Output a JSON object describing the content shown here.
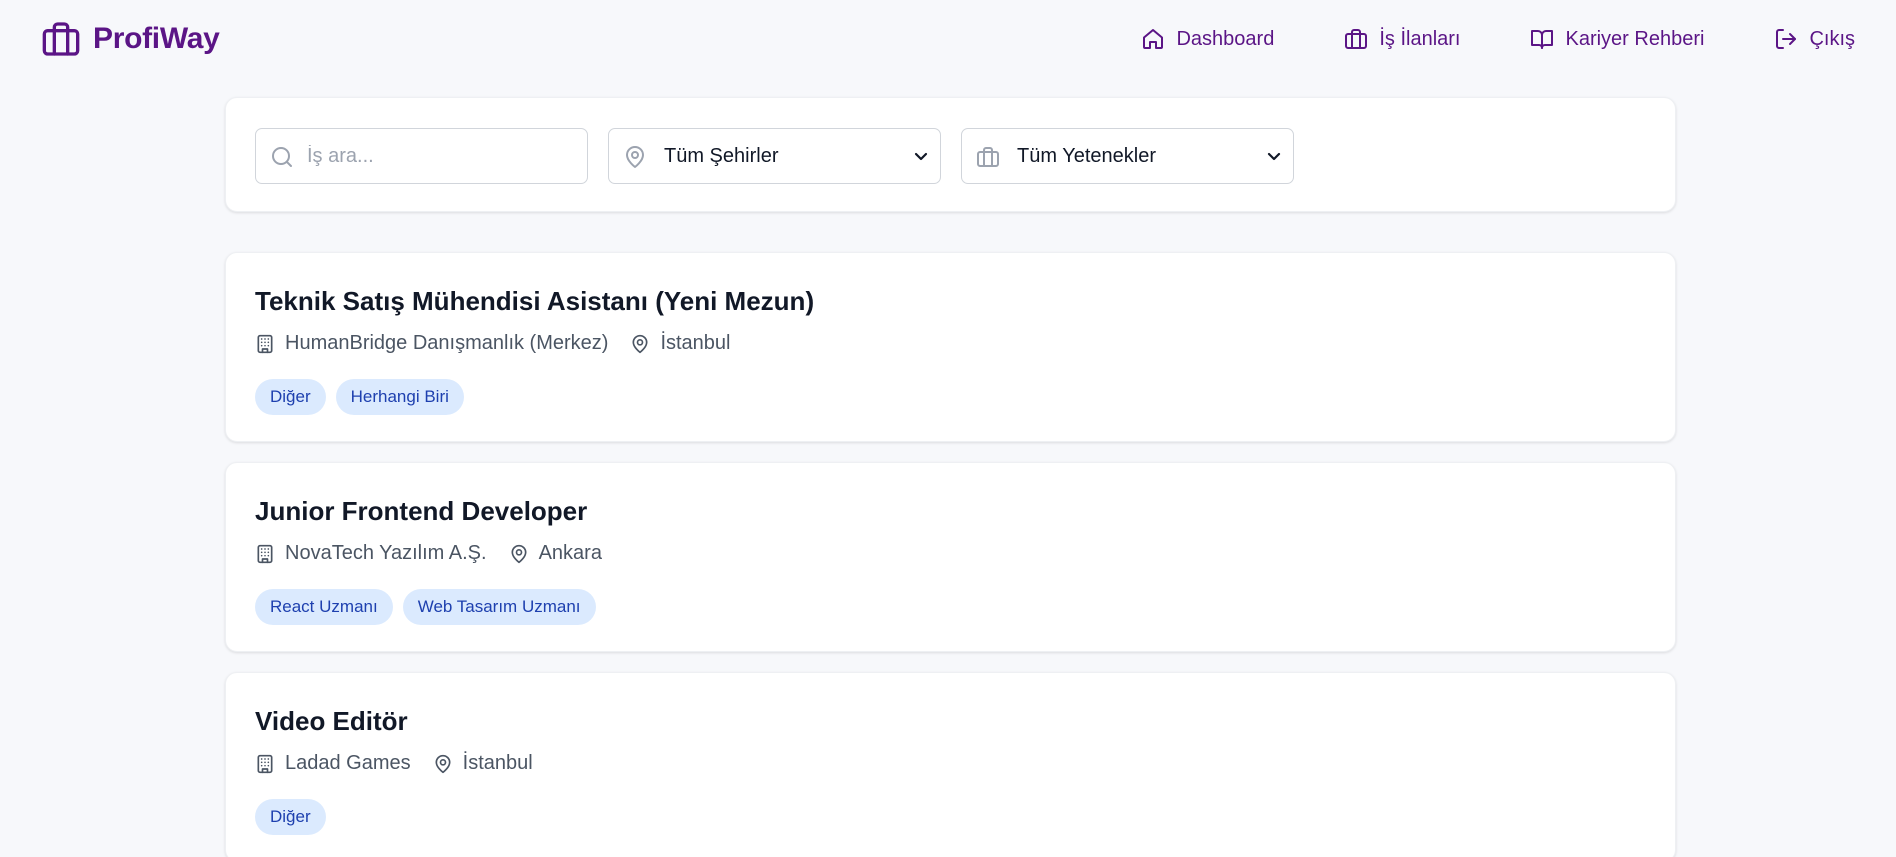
{
  "header": {
    "brand": "ProfiWay",
    "nav": [
      {
        "label": "Dashboard",
        "icon": "home-icon"
      },
      {
        "label": "İş İlanları",
        "icon": "briefcase-icon"
      },
      {
        "label": "Kariyer Rehberi",
        "icon": "book-open-icon"
      },
      {
        "label": "Çıkış",
        "icon": "logout-icon"
      }
    ]
  },
  "filters": {
    "search_placeholder": "İş ara...",
    "city_selected": "Tüm Şehirler",
    "skill_selected": "Tüm Yetenekler"
  },
  "jobs": [
    {
      "title": "Teknik Satış Mühendisi Asistanı (Yeni Mezun)",
      "company": "HumanBridge Danışmanlık (Merkez)",
      "city": "İstanbul",
      "tags": [
        "Diğer",
        "Herhangi Biri"
      ]
    },
    {
      "title": "Junior Frontend Developer",
      "company": "NovaTech Yazılım A.Ş.",
      "city": "Ankara",
      "tags": [
        "React Uzmanı",
        "Web Tasarım Uzmanı"
      ]
    },
    {
      "title": "Video Editör",
      "company": "Ladad Games",
      "city": "İstanbul",
      "tags": [
        "Diğer"
      ]
    }
  ],
  "colors": {
    "brand": "#5b1586",
    "tag_bg": "#dbeafe",
    "tag_text": "#1e40af",
    "page_bg": "#f7f8fb"
  }
}
